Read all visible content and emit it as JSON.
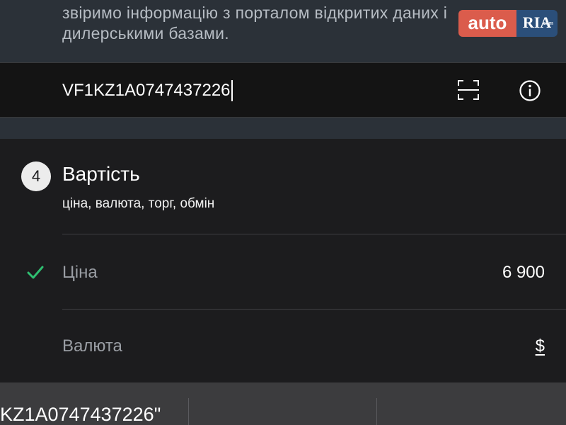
{
  "intro": {
    "text": "звіримо інформацію з порталом відкритих даних і дилерськими базами."
  },
  "logo": {
    "auto": "auto",
    "ria": "RIA",
    "com": ".com",
    "colors": {
      "auto_bg": "#db5c4c",
      "ria_bg": "#2b4f7a"
    }
  },
  "vin": {
    "value": "VF1KZ1A0747437226",
    "scan_icon": "scan-frame-icon",
    "info_icon": "info-circle-icon"
  },
  "price_section": {
    "step_number": "4",
    "title": "Вартість",
    "subtitle": "ціна, валюта, торг, обмін",
    "rows": [
      {
        "label": "Ціна",
        "value": "6 900",
        "checked": true
      },
      {
        "label": "Валюта",
        "value": "$",
        "checked": false
      }
    ],
    "check_color": "#2fbf71"
  },
  "keyboard": {
    "suggestion": "KZ1A0747437226\""
  }
}
